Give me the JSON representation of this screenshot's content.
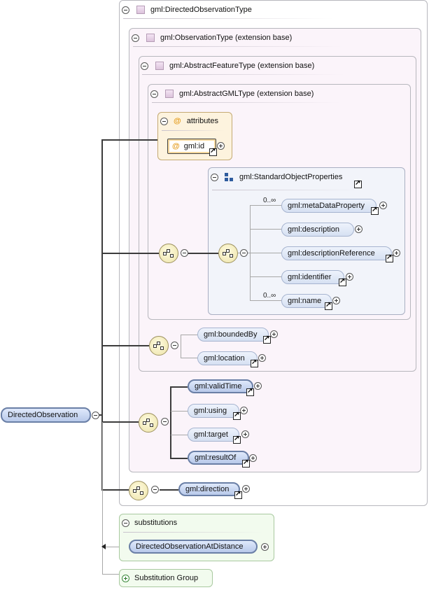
{
  "types": {
    "directed_observation_type": "gml:DirectedObservationType",
    "observation_type": "gml:ObservationType (extension base)",
    "abstract_feature_type": "gml:AbstractFeatureType (extension base)",
    "abstract_gml_type": "gml:AbstractGMLType (extension base)"
  },
  "attributes": {
    "label": "attributes",
    "at_symbol": "@",
    "id": "gml:id"
  },
  "standard_object_properties": {
    "title": "gml:StandardObjectProperties",
    "elements": [
      "gml:metaDataProperty",
      "gml:description",
      "gml:descriptionReference",
      "gml:identifier",
      "gml:name"
    ],
    "cardinality_top": "0..∞",
    "cardinality_name": "0..∞"
  },
  "feature_elements": [
    "gml:boundedBy",
    "gml:location"
  ],
  "observation_elements": [
    "gml:validTime",
    "gml:using",
    "gml:target",
    "gml:resultOf"
  ],
  "direction_element": "gml:direction",
  "root_element": "DirectedObservation",
  "substitutions": {
    "label": "substitutions",
    "element": "DirectedObservationAtDistance"
  },
  "substitution_group": {
    "label": "Substitution Group"
  },
  "colors": {
    "type_frame_bg": "#fbf4fa",
    "attribute_bg": "#fdf3de",
    "element_blue": "#b8c9ea",
    "sequence_yellow": "#ece3a8",
    "substitution_bg": "#f2fbee"
  },
  "icons": [
    "collapse-icon",
    "expand-icon",
    "type-icon",
    "attribute-icon",
    "group-icon",
    "sequence-icon",
    "link-icon"
  ]
}
